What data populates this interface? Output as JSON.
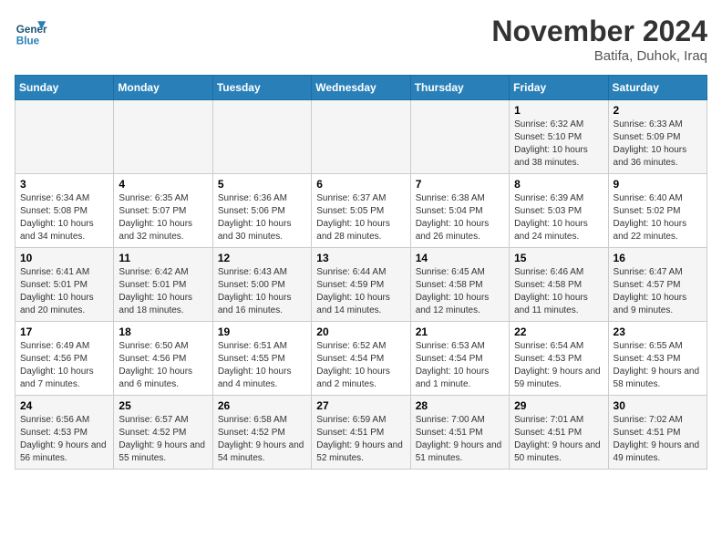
{
  "logo": {
    "line1": "General",
    "line2": "Blue"
  },
  "title": "November 2024",
  "subtitle": "Batifa, Duhok, Iraq",
  "days_of_week": [
    "Sunday",
    "Monday",
    "Tuesday",
    "Wednesday",
    "Thursday",
    "Friday",
    "Saturday"
  ],
  "weeks": [
    [
      {
        "day": "",
        "details": ""
      },
      {
        "day": "",
        "details": ""
      },
      {
        "day": "",
        "details": ""
      },
      {
        "day": "",
        "details": ""
      },
      {
        "day": "",
        "details": ""
      },
      {
        "day": "1",
        "details": "Sunrise: 6:32 AM\nSunset: 5:10 PM\nDaylight: 10 hours and 38 minutes."
      },
      {
        "day": "2",
        "details": "Sunrise: 6:33 AM\nSunset: 5:09 PM\nDaylight: 10 hours and 36 minutes."
      }
    ],
    [
      {
        "day": "3",
        "details": "Sunrise: 6:34 AM\nSunset: 5:08 PM\nDaylight: 10 hours and 34 minutes."
      },
      {
        "day": "4",
        "details": "Sunrise: 6:35 AM\nSunset: 5:07 PM\nDaylight: 10 hours and 32 minutes."
      },
      {
        "day": "5",
        "details": "Sunrise: 6:36 AM\nSunset: 5:06 PM\nDaylight: 10 hours and 30 minutes."
      },
      {
        "day": "6",
        "details": "Sunrise: 6:37 AM\nSunset: 5:05 PM\nDaylight: 10 hours and 28 minutes."
      },
      {
        "day": "7",
        "details": "Sunrise: 6:38 AM\nSunset: 5:04 PM\nDaylight: 10 hours and 26 minutes."
      },
      {
        "day": "8",
        "details": "Sunrise: 6:39 AM\nSunset: 5:03 PM\nDaylight: 10 hours and 24 minutes."
      },
      {
        "day": "9",
        "details": "Sunrise: 6:40 AM\nSunset: 5:02 PM\nDaylight: 10 hours and 22 minutes."
      }
    ],
    [
      {
        "day": "10",
        "details": "Sunrise: 6:41 AM\nSunset: 5:01 PM\nDaylight: 10 hours and 20 minutes."
      },
      {
        "day": "11",
        "details": "Sunrise: 6:42 AM\nSunset: 5:01 PM\nDaylight: 10 hours and 18 minutes."
      },
      {
        "day": "12",
        "details": "Sunrise: 6:43 AM\nSunset: 5:00 PM\nDaylight: 10 hours and 16 minutes."
      },
      {
        "day": "13",
        "details": "Sunrise: 6:44 AM\nSunset: 4:59 PM\nDaylight: 10 hours and 14 minutes."
      },
      {
        "day": "14",
        "details": "Sunrise: 6:45 AM\nSunset: 4:58 PM\nDaylight: 10 hours and 12 minutes."
      },
      {
        "day": "15",
        "details": "Sunrise: 6:46 AM\nSunset: 4:58 PM\nDaylight: 10 hours and 11 minutes."
      },
      {
        "day": "16",
        "details": "Sunrise: 6:47 AM\nSunset: 4:57 PM\nDaylight: 10 hours and 9 minutes."
      }
    ],
    [
      {
        "day": "17",
        "details": "Sunrise: 6:49 AM\nSunset: 4:56 PM\nDaylight: 10 hours and 7 minutes."
      },
      {
        "day": "18",
        "details": "Sunrise: 6:50 AM\nSunset: 4:56 PM\nDaylight: 10 hours and 6 minutes."
      },
      {
        "day": "19",
        "details": "Sunrise: 6:51 AM\nSunset: 4:55 PM\nDaylight: 10 hours and 4 minutes."
      },
      {
        "day": "20",
        "details": "Sunrise: 6:52 AM\nSunset: 4:54 PM\nDaylight: 10 hours and 2 minutes."
      },
      {
        "day": "21",
        "details": "Sunrise: 6:53 AM\nSunset: 4:54 PM\nDaylight: 10 hours and 1 minute."
      },
      {
        "day": "22",
        "details": "Sunrise: 6:54 AM\nSunset: 4:53 PM\nDaylight: 9 hours and 59 minutes."
      },
      {
        "day": "23",
        "details": "Sunrise: 6:55 AM\nSunset: 4:53 PM\nDaylight: 9 hours and 58 minutes."
      }
    ],
    [
      {
        "day": "24",
        "details": "Sunrise: 6:56 AM\nSunset: 4:53 PM\nDaylight: 9 hours and 56 minutes."
      },
      {
        "day": "25",
        "details": "Sunrise: 6:57 AM\nSunset: 4:52 PM\nDaylight: 9 hours and 55 minutes."
      },
      {
        "day": "26",
        "details": "Sunrise: 6:58 AM\nSunset: 4:52 PM\nDaylight: 9 hours and 54 minutes."
      },
      {
        "day": "27",
        "details": "Sunrise: 6:59 AM\nSunset: 4:51 PM\nDaylight: 9 hours and 52 minutes."
      },
      {
        "day": "28",
        "details": "Sunrise: 7:00 AM\nSunset: 4:51 PM\nDaylight: 9 hours and 51 minutes."
      },
      {
        "day": "29",
        "details": "Sunrise: 7:01 AM\nSunset: 4:51 PM\nDaylight: 9 hours and 50 minutes."
      },
      {
        "day": "30",
        "details": "Sunrise: 7:02 AM\nSunset: 4:51 PM\nDaylight: 9 hours and 49 minutes."
      }
    ]
  ]
}
